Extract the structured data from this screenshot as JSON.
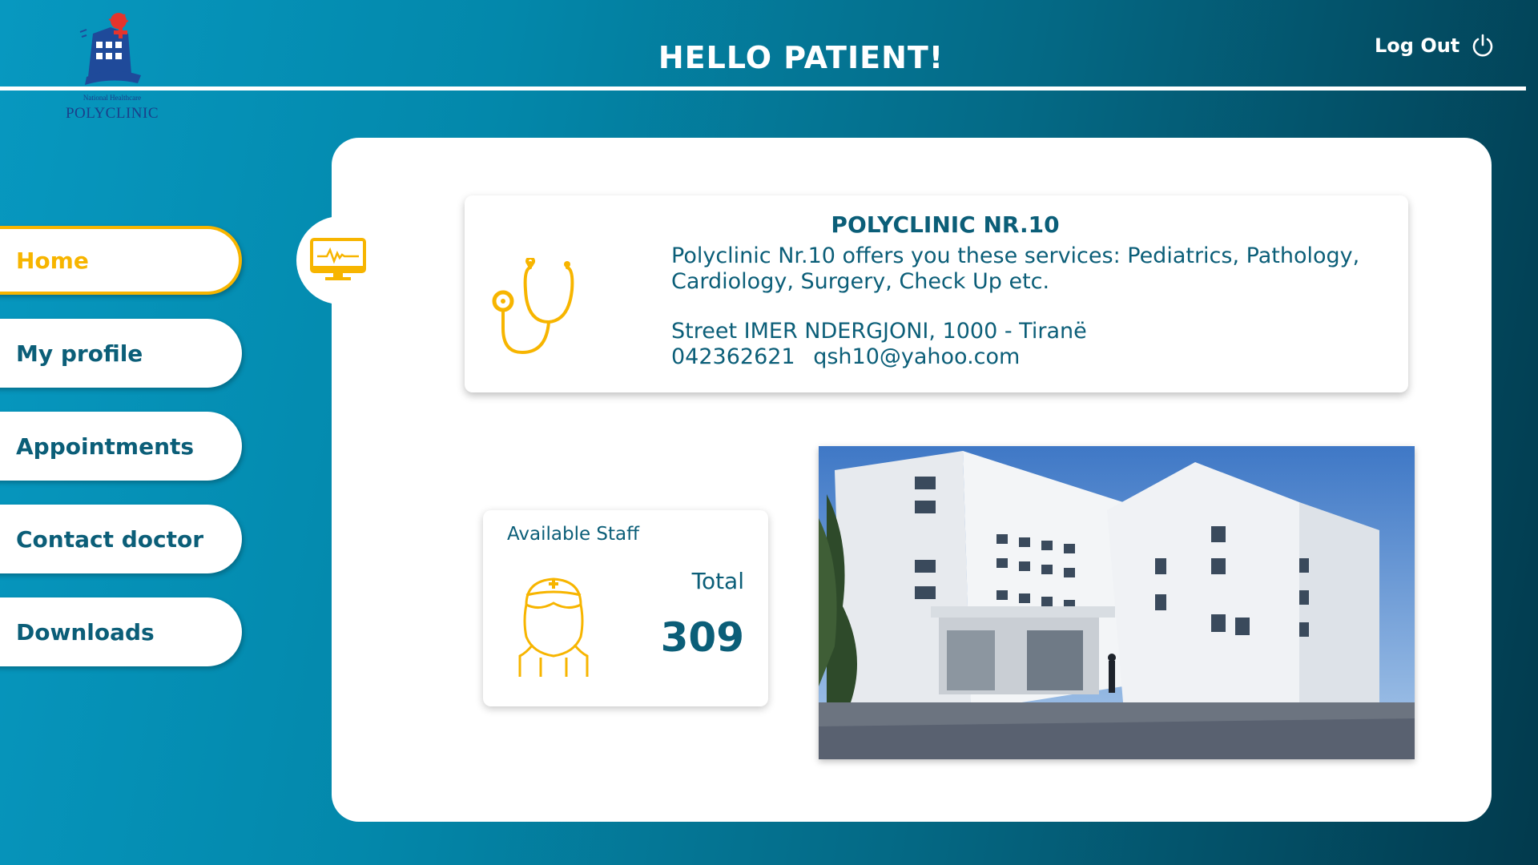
{
  "header": {
    "logo_subtitle": "National Healthcare",
    "logo_title": "POLYCLINIC",
    "greeting": "HELLO PATIENT!",
    "logout_label": "Log Out",
    "logout_icon": "power-icon"
  },
  "sidebar": {
    "items": [
      {
        "label": "Home",
        "active": true
      },
      {
        "label": "My profile",
        "active": false
      },
      {
        "label": "Appointments",
        "active": false
      },
      {
        "label": "Contact doctor",
        "active": false
      },
      {
        "label": "Downloads",
        "active": false
      }
    ]
  },
  "main": {
    "tab_icon": "monitor-heartbeat-icon",
    "info": {
      "title": "POLYCLINIC NR.10",
      "description": "Polyclinic Nr.10 offers you these services: Pediatrics, Pathology, Cardiology, Surgery, Check Up etc.",
      "address": "Street IMER NDERGJONI, 1000 - Tiranë",
      "phone": "042362621",
      "email": "qsh10@yahoo.com",
      "icon": "stethoscope-icon"
    },
    "staff": {
      "label": "Available Staff",
      "total_label": "Total",
      "total_value": "309",
      "icon": "nurse-icon"
    }
  },
  "colors": {
    "accent": "#f7b500",
    "text": "#0b5e78",
    "background_start": "#0798c0",
    "background_end": "#023a4d"
  }
}
